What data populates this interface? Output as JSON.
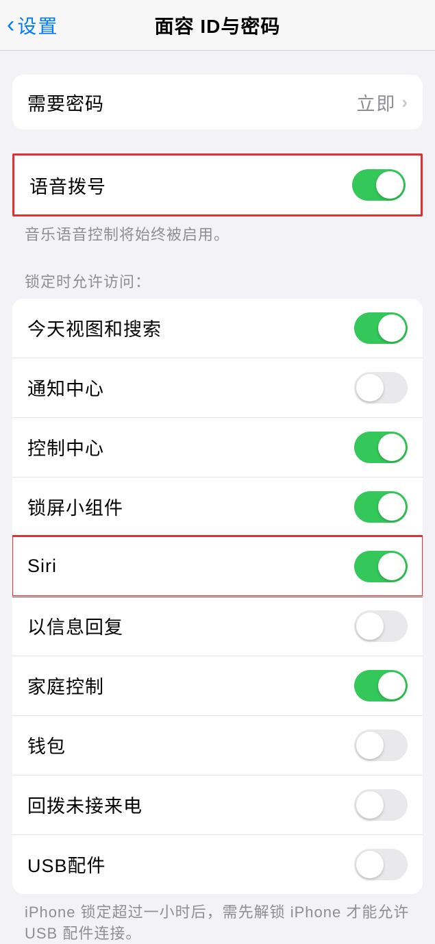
{
  "header": {
    "back_label": "设置",
    "title": "面容 ID与密码"
  },
  "passcode_section": {
    "require_passcode_label": "需要密码",
    "require_passcode_value": "立即"
  },
  "voice_dial": {
    "label": "语音拨号",
    "on": true,
    "footer": "音乐语音控制将始终被启用。"
  },
  "lock_access": {
    "header": "锁定时允许访问：",
    "items": [
      {
        "label": "今天视图和搜索",
        "on": true
      },
      {
        "label": "通知中心",
        "on": false
      },
      {
        "label": "控制中心",
        "on": true
      },
      {
        "label": "锁屏小组件",
        "on": true
      },
      {
        "label": "Siri",
        "on": true,
        "highlighted": true
      },
      {
        "label": "以信息回复",
        "on": false
      },
      {
        "label": "家庭控制",
        "on": true
      },
      {
        "label": "钱包",
        "on": false
      },
      {
        "label": "回拨未接来电",
        "on": false
      },
      {
        "label": "USB配件",
        "on": false
      }
    ],
    "footer": "iPhone 锁定超过一小时后，需先解锁 iPhone 才能允许 USB 配件连接。"
  }
}
